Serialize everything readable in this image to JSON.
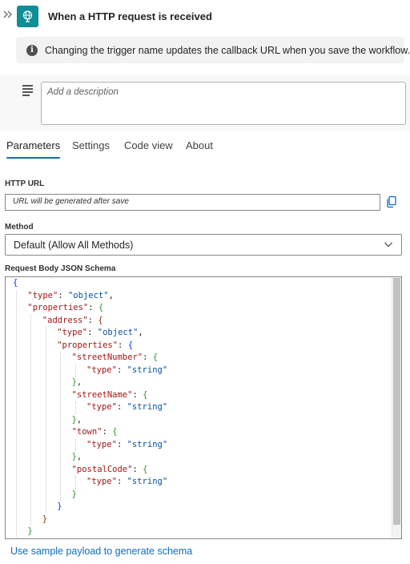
{
  "header": {
    "title": "When a HTTP request is received",
    "collapse_icon": "double-chevron-right-icon",
    "trigger_icon": "globe-request-icon"
  },
  "info": {
    "text": "Changing the trigger name updates the callback URL when you save the workflow."
  },
  "description": {
    "placeholder": "Add a description"
  },
  "tabs": [
    {
      "label": "Parameters",
      "active": true
    },
    {
      "label": "Settings"
    },
    {
      "label": "Code view"
    },
    {
      "label": "About"
    }
  ],
  "fields": {
    "http_url_label": "HTTP URL",
    "http_url_value": "URL will be generated after save",
    "method_label": "Method",
    "method_value": "Default (Allow All Methods)",
    "schema_label": "Request Body JSON Schema"
  },
  "schema_lines": [
    {
      "indent": 0,
      "key": "",
      "value": "",
      "open": "{",
      "close": "",
      "bc": "b1"
    },
    {
      "indent": 1,
      "key": "\"type\"",
      "value": "\"object\"",
      "open": "",
      "close": "",
      "bc": ""
    },
    {
      "indent": 1,
      "key": "\"properties\"",
      "value": "",
      "open": "{",
      "close": "",
      "bc": "b2"
    },
    {
      "indent": 2,
      "key": "\"address\"",
      "value": "",
      "open": "{",
      "close": "",
      "bc": "b3"
    },
    {
      "indent": 3,
      "key": "\"type\"",
      "value": "\"object\"",
      "open": "",
      "close": "",
      "bc": ""
    },
    {
      "indent": 3,
      "key": "\"properties\"",
      "value": "",
      "open": "{",
      "close": "",
      "bc": "b1"
    },
    {
      "indent": 4,
      "key": "\"streetNumber\"",
      "value": "",
      "open": "{",
      "close": "",
      "bc": "b2"
    },
    {
      "indent": 5,
      "key": "\"type\"",
      "value": "\"string\"",
      "open": "",
      "close": "",
      "bc": ""
    },
    {
      "indent": 4,
      "key": "",
      "value": "",
      "open": "",
      "close": "},",
      "bc": "b2"
    },
    {
      "indent": 4,
      "key": "\"streetName\"",
      "value": "",
      "open": "{",
      "close": "",
      "bc": "b2"
    },
    {
      "indent": 5,
      "key": "\"type\"",
      "value": "\"string\"",
      "open": "",
      "close": "",
      "bc": ""
    },
    {
      "indent": 4,
      "key": "",
      "value": "",
      "open": "",
      "close": "},",
      "bc": "b2"
    },
    {
      "indent": 4,
      "key": "\"town\"",
      "value": "",
      "open": "{",
      "close": "",
      "bc": "b2"
    },
    {
      "indent": 5,
      "key": "\"type\"",
      "value": "\"string\"",
      "open": "",
      "close": "",
      "bc": ""
    },
    {
      "indent": 4,
      "key": "",
      "value": "",
      "open": "",
      "close": "},",
      "bc": "b2"
    },
    {
      "indent": 4,
      "key": "\"postalCode\"",
      "value": "",
      "open": "{",
      "close": "",
      "bc": "b2"
    },
    {
      "indent": 5,
      "key": "\"type\"",
      "value": "\"string\"",
      "open": "",
      "close": "",
      "bc": ""
    },
    {
      "indent": 4,
      "key": "",
      "value": "",
      "open": "",
      "close": "}",
      "bc": "b2"
    },
    {
      "indent": 3,
      "key": "",
      "value": "",
      "open": "",
      "close": "}",
      "bc": "b1"
    },
    {
      "indent": 2,
      "key": "",
      "value": "",
      "open": "",
      "close": "}",
      "bc": "b3"
    },
    {
      "indent": 1,
      "key": "",
      "value": "",
      "open": "",
      "close": "}",
      "bc": "b2"
    }
  ],
  "footer": {
    "sample_link": "Use sample payload to generate schema"
  },
  "colors": {
    "accent": "#0f6cbd",
    "trigger_icon_bg": "#0f8e95"
  }
}
